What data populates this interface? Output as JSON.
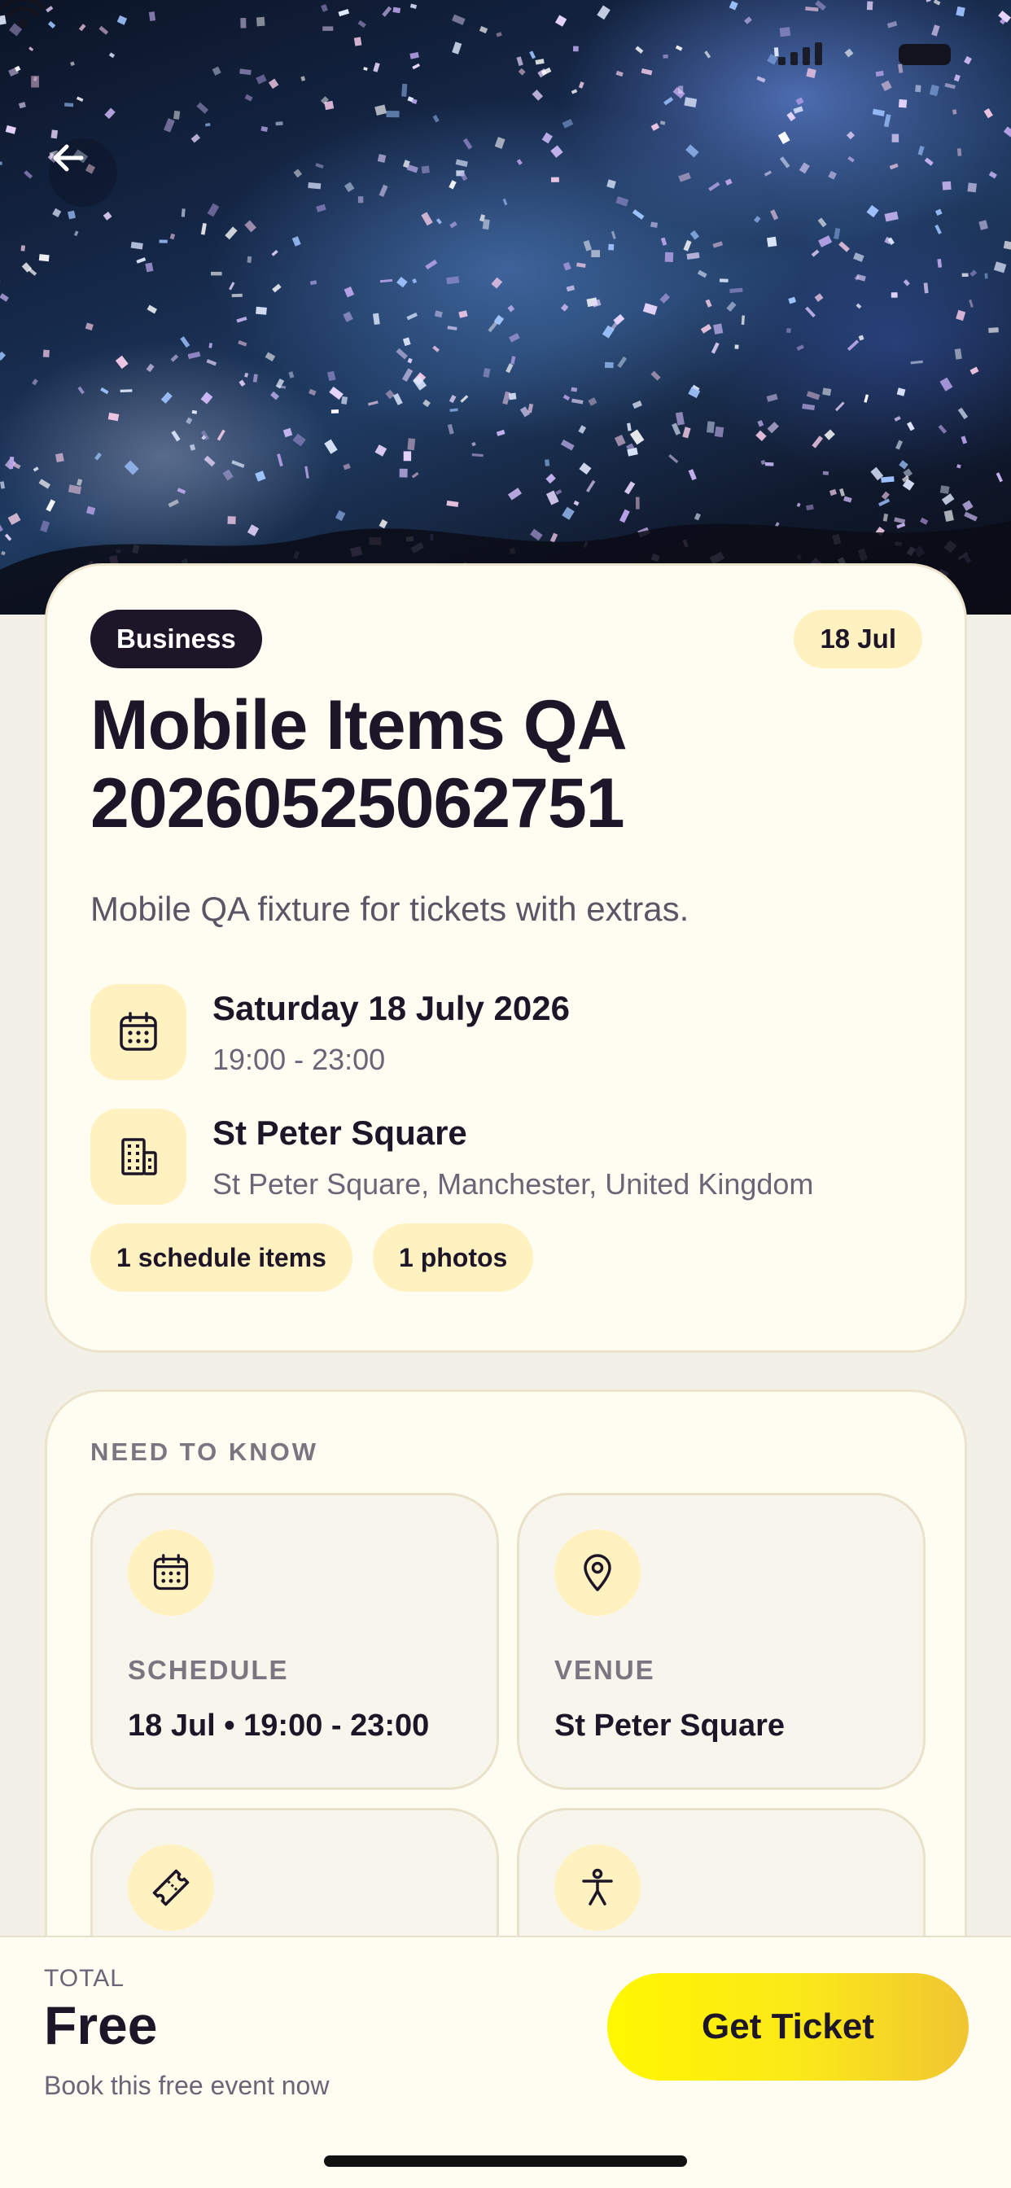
{
  "hero": {
    "image_alt": "Concert confetti crowd photo",
    "back_icon": "arrow-left-icon"
  },
  "status_bar": {
    "icons": [
      "signal-icon",
      "wifi-icon",
      "battery-icon"
    ]
  },
  "event": {
    "category": "Business",
    "date_badge": "18 Jul",
    "title": "Mobile Items QA 20260525062751",
    "description": "Mobile QA fixture for tickets with extras.",
    "date_line": "Saturday 18 July 2026",
    "time_line": "19:00 - 23:00",
    "venue_name": "St Peter Square",
    "venue_address": "St Peter Square, Manchester, United Kingdom",
    "chips": [
      "1 schedule items",
      "1 photos"
    ]
  },
  "need_to_know": {
    "heading": "NEED TO KNOW",
    "tiles": [
      {
        "icon": "calendar-icon",
        "label": "SCHEDULE",
        "value": "18 Jul • 19:00 - 23:00"
      },
      {
        "icon": "map-pin-icon",
        "label": "VENUE",
        "value": "St Peter Square"
      },
      {
        "icon": "ticket-icon",
        "label": "",
        "value": ""
      },
      {
        "icon": "accessibility-icon",
        "label": "",
        "value": ""
      }
    ]
  },
  "checkout": {
    "total_label": "TOTAL",
    "total_value": "Free",
    "total_sub": "Book this free event now",
    "cta_label": "Get Ticket"
  },
  "colors": {
    "accent_yellow": "#fff700",
    "pill_dark": "#1d1629",
    "pill_light": "#fff2c0",
    "card_bg": "#fffcf2",
    "page_bg": "#f3f0e7"
  }
}
